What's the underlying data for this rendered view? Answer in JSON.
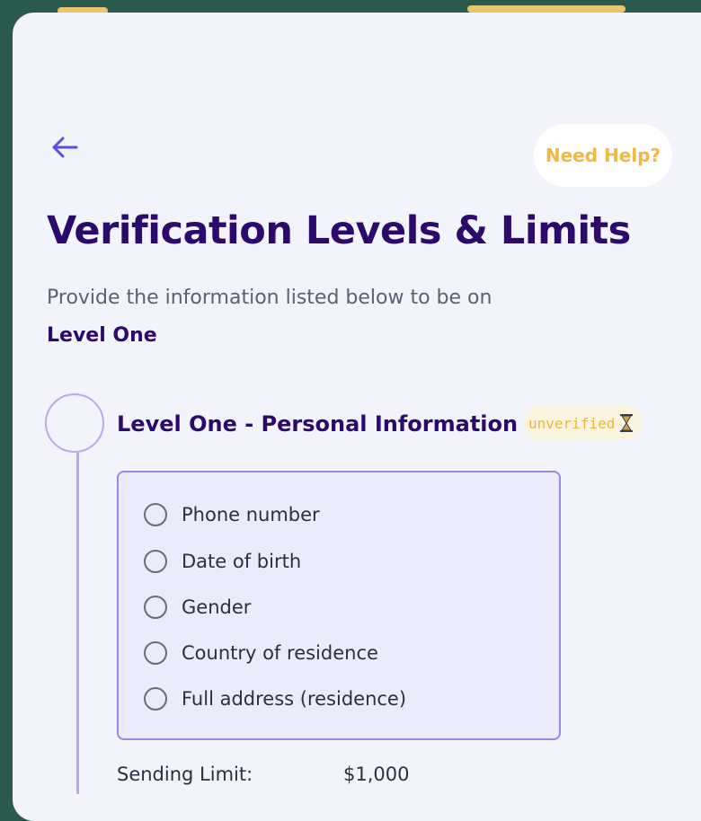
{
  "header": {
    "help_label": "Need Help?"
  },
  "page": {
    "title": "Verification Levels & Limits",
    "subtitle": "Provide the information listed below to be on",
    "level_name": "Level One"
  },
  "level": {
    "title": "Level One - Personal Information",
    "status": "unverified",
    "requirements": [
      {
        "label": "Phone number"
      },
      {
        "label": "Date of birth"
      },
      {
        "label": "Gender"
      },
      {
        "label": "Country of residence"
      },
      {
        "label": "Full address (residence)"
      }
    ],
    "sending_limit_label": "Sending Limit:",
    "sending_limit_value": "$1,000"
  },
  "colors": {
    "background": "#2a5a4c",
    "card": "#f3f3fb",
    "heading": "#2b0a6b",
    "accent": "#5b4fe0",
    "help": "#f0b840",
    "badge_text": "#e8b83e"
  },
  "icons": {
    "back": "arrow-left-icon",
    "status": "hourglass-icon",
    "radio": "radio-unchecked-icon"
  }
}
